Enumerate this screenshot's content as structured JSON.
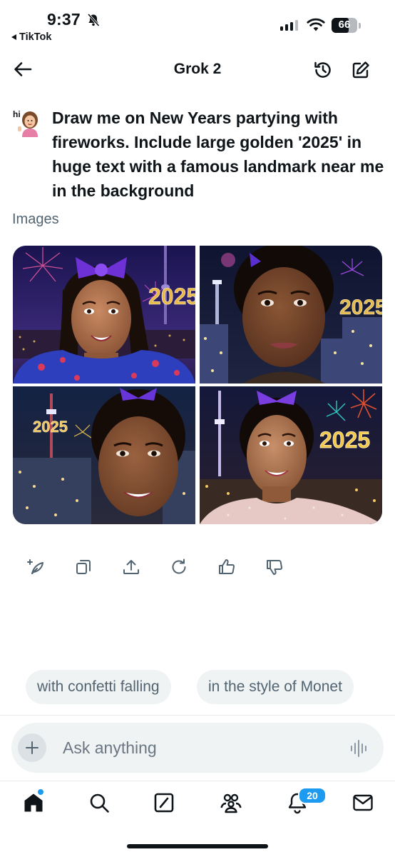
{
  "status_bar": {
    "time": "9:37",
    "back_app": "TikTok",
    "battery": "66"
  },
  "header": {
    "title": "Grok 2"
  },
  "message": {
    "avatar_text": "hi",
    "prompt": "Draw me on New Years partying with fireworks. Include large golden '2025' in huge text with a famous landmark near me in the background"
  },
  "images": {
    "label": "Images",
    "year_text": "2025"
  },
  "suggestions": [
    {
      "label": "with confetti falling"
    },
    {
      "label": "in the style of Monet"
    }
  ],
  "composer": {
    "placeholder": "Ask anything"
  },
  "tabbar": {
    "notifications_badge": "20"
  },
  "colors": {
    "accent": "#1d9bf0",
    "text": "#0f1419",
    "muted": "#536471",
    "chip_bg": "#eff3f4"
  },
  "icons": [
    "back-arrow-icon",
    "history-icon",
    "new-chat-icon",
    "edit-image-icon",
    "copy-icon",
    "share-icon",
    "regenerate-icon",
    "thumbs-up-icon",
    "thumbs-down-icon",
    "plus-icon",
    "voice-icon",
    "home-icon",
    "search-icon",
    "grok-icon",
    "communities-icon",
    "notifications-icon",
    "messages-icon"
  ]
}
